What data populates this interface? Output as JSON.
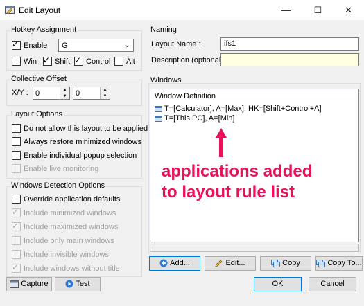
{
  "window": {
    "title": "Edit Layout",
    "minimize_glyph": "—",
    "maximize_glyph": "☐",
    "close_glyph": "✕"
  },
  "hotkey": {
    "group_title": "Hotkey Assignment",
    "enable_label": "Enable",
    "key_value": "G",
    "win_label": "Win",
    "shift_label": "Shift",
    "control_label": "Control",
    "alt_label": "Alt"
  },
  "offset": {
    "group_title": "Collective Offset",
    "xy_label": "X/Y :",
    "x_value": "0",
    "y_value": "0"
  },
  "layout_options": {
    "group_title": "Layout Options",
    "items": [
      "Do not allow this layout to be applied",
      "Always restore minimized windows",
      "Enable individual popup selection",
      "Enable live monitoring"
    ]
  },
  "detection": {
    "group_title": "Windows Detection Options",
    "items": [
      "Override application defaults",
      "Include minimized windows",
      "Include maximized windows",
      "Include only main windows",
      "Include invisible windows",
      "Include windows without title"
    ]
  },
  "naming": {
    "group_title": "Naming",
    "name_label": "Layout Name :",
    "name_value": "ifs1",
    "desc_label": "Description (optional) :",
    "desc_value": ""
  },
  "windows": {
    "group_title": "Windows",
    "list_header": "Window Definition",
    "entries": [
      "T=[Calculator], A=[Max], HK=[Shift+Control+A]",
      "T=[This PC], A=[Min]"
    ]
  },
  "annotation": {
    "line1": "applications added",
    "line2": "to layout rule list",
    "color": "#e8125a"
  },
  "buttons": {
    "add": "Add...",
    "edit": "Edit...",
    "copy": "Copy",
    "copy_to": "Copy To...",
    "capture": "Capture",
    "test": "Test",
    "ok": "OK",
    "cancel": "Cancel"
  }
}
